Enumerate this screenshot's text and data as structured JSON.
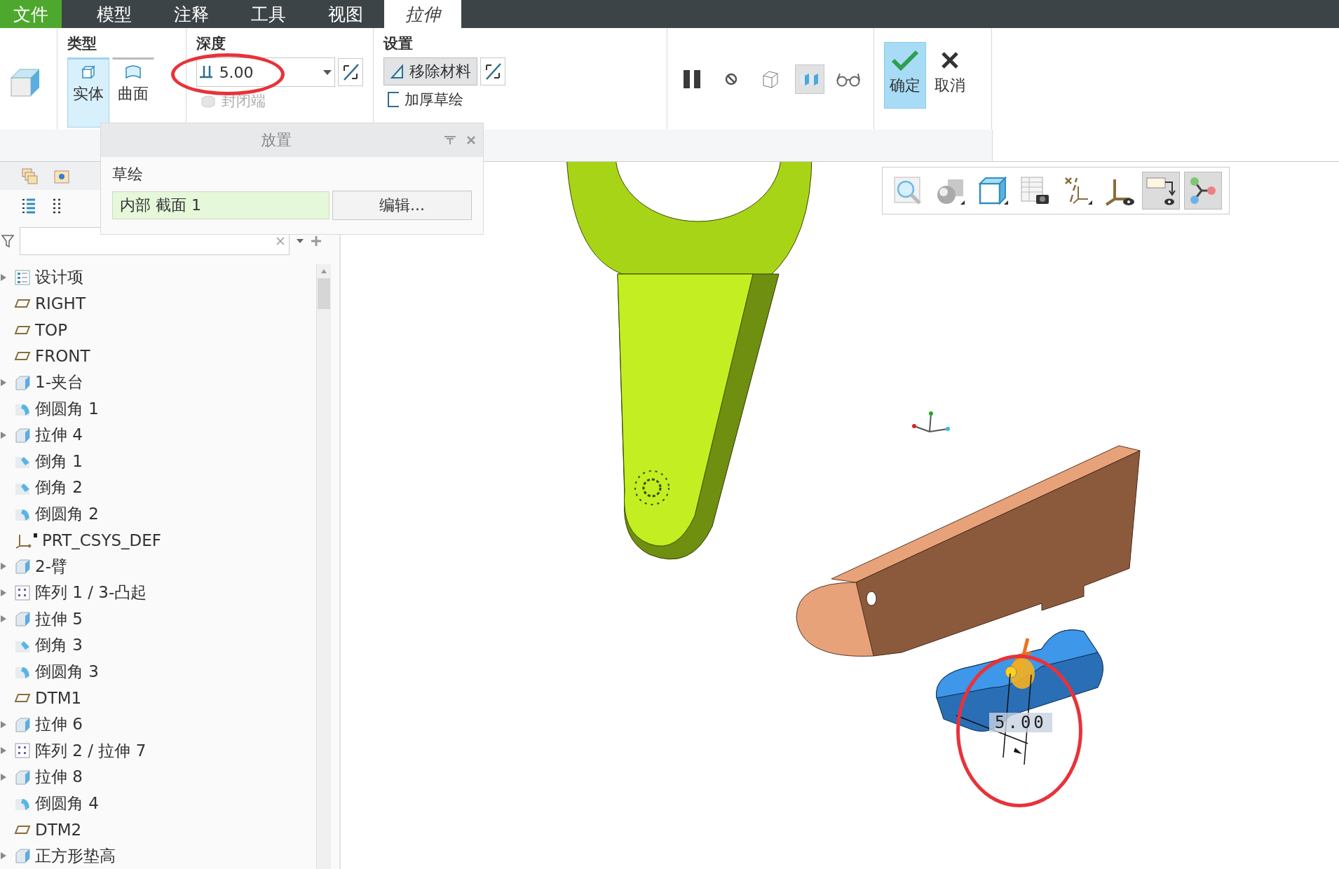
{
  "menu_tabs": [
    {
      "label": "文件",
      "kind": "file",
      "selected": false
    },
    {
      "label": "模型",
      "kind": "ribbon",
      "selected": false
    },
    {
      "label": "注释",
      "kind": "ribbon",
      "selected": false
    },
    {
      "label": "工具",
      "kind": "ribbon",
      "selected": false
    },
    {
      "label": "视图",
      "kind": "ribbon",
      "selected": false
    },
    {
      "label": "拉伸",
      "kind": "ribbon",
      "selected": true
    }
  ],
  "ribbon": {
    "type_group": {
      "title": "类型",
      "options": [
        {
          "label": "实体",
          "kind": "solid",
          "selected": true
        },
        {
          "label": "曲面",
          "kind": "surface",
          "selected": false
        }
      ]
    },
    "depth_group": {
      "title": "深度",
      "value": "5.00",
      "capped_ends": {
        "label": "封闭端",
        "disabled": true
      }
    },
    "settings_group": {
      "title": "设置",
      "remove_material": {
        "label": "移除材料",
        "on": true
      },
      "thicken_sketch": {
        "label": "加厚草绘",
        "checked": false
      }
    },
    "preview_tools": [
      {
        "kind": "pause",
        "selected": false
      },
      {
        "kind": "stop",
        "selected": false
      },
      {
        "kind": "wireframe",
        "selected": false
      },
      {
        "kind": "preview",
        "selected": true
      },
      {
        "kind": "glasses",
        "selected": false
      }
    ],
    "ok": "确定",
    "cancel": "取消"
  },
  "placement_panel": {
    "title": "放置",
    "sketch_label": "草绘",
    "sketch_value": "内部 截面 1",
    "edit_button": "编辑..."
  },
  "model_tree": {
    "items": [
      {
        "label": "设计项",
        "kind": "list",
        "expandable": true
      },
      {
        "label": "RIGHT",
        "kind": "plane",
        "expandable": false
      },
      {
        "label": "TOP",
        "kind": "plane",
        "expandable": false
      },
      {
        "label": "FRONT",
        "kind": "plane",
        "expandable": false
      },
      {
        "label": "1-夹台",
        "kind": "extrude",
        "expandable": true
      },
      {
        "label": "倒圆角 1",
        "kind": "round",
        "expandable": false
      },
      {
        "label": "拉伸 4",
        "kind": "extrude",
        "expandable": true
      },
      {
        "label": "倒角 1",
        "kind": "chamfer",
        "expandable": false
      },
      {
        "label": "倒角 2",
        "kind": "chamfer",
        "expandable": false
      },
      {
        "label": "倒圆角 2",
        "kind": "round",
        "expandable": false
      },
      {
        "label": "PRT_CSYS_DEF",
        "kind": "csys",
        "expandable": false
      },
      {
        "label": "2-臂",
        "kind": "extrude",
        "expandable": true
      },
      {
        "label": "阵列 1 / 3-凸起",
        "kind": "pattern",
        "expandable": true
      },
      {
        "label": "拉伸 5",
        "kind": "extrude",
        "expandable": true
      },
      {
        "label": "倒角 3",
        "kind": "chamfer",
        "expandable": false
      },
      {
        "label": "倒圆角 3",
        "kind": "round",
        "expandable": false
      },
      {
        "label": "DTM1",
        "kind": "plane",
        "expandable": false
      },
      {
        "label": "拉伸 6",
        "kind": "extrude",
        "expandable": true
      },
      {
        "label": "阵列 2 / 拉伸 7",
        "kind": "pattern",
        "expandable": true
      },
      {
        "label": "拉伸 8",
        "kind": "extrude",
        "expandable": true
      },
      {
        "label": "倒圆角 4",
        "kind": "round",
        "expandable": false
      },
      {
        "label": "DTM2",
        "kind": "plane",
        "expandable": false
      },
      {
        "label": "正方形垫高",
        "kind": "extrude",
        "expandable": true
      }
    ]
  },
  "view_toolbar": [
    {
      "kind": "zoom",
      "selected": false
    },
    {
      "kind": "shading",
      "selected": false
    },
    {
      "kind": "views",
      "selected": false
    },
    {
      "kind": "snapshot",
      "selected": false
    },
    {
      "kind": "datum",
      "selected": false
    },
    {
      "kind": "csys",
      "selected": false
    },
    {
      "kind": "annotation",
      "selected": true
    },
    {
      "kind": "nodes",
      "selected": true
    }
  ],
  "viewport": {
    "dimension": "5.00"
  }
}
